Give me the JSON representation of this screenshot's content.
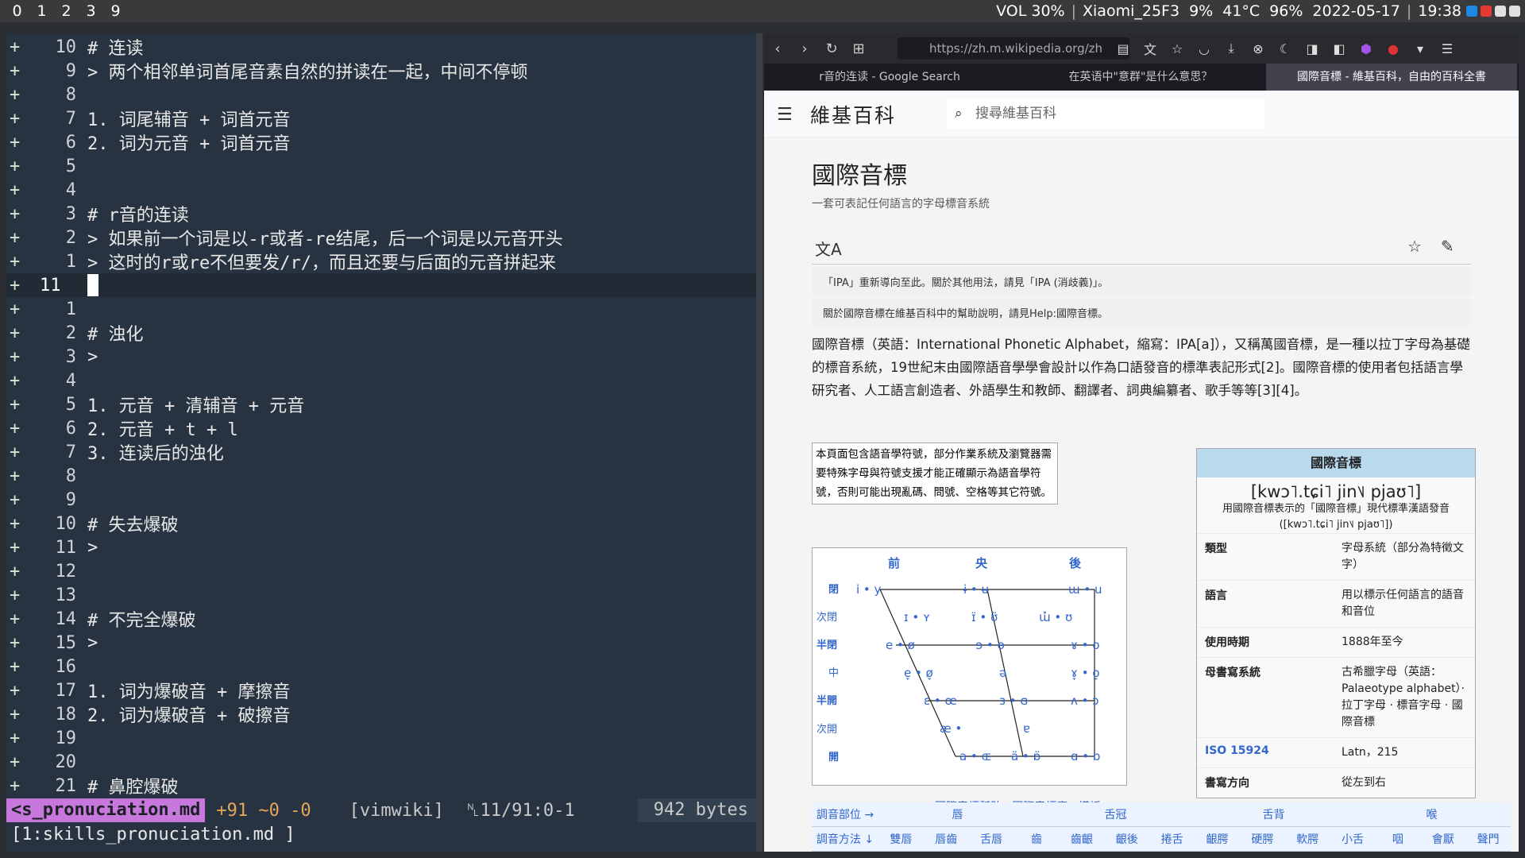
{
  "topbar": {
    "workspaces": [
      "0",
      "1",
      "2",
      "3",
      "9"
    ],
    "volume": "VOL 30%",
    "wifi": "Xiaomi_25F3",
    "cpu": "9%",
    "temp": "41°C",
    "battery": "96%",
    "date": "2022-05-17",
    "time": "19:38"
  },
  "vim": {
    "lines": [
      {
        "plus": "+",
        "num": "10",
        "text": "# 连读"
      },
      {
        "plus": "+",
        "num": "9",
        "text": "> 两个相邻单词首尾音素自然的拼读在一起，中间不停顿"
      },
      {
        "plus": "+",
        "num": "8",
        "text": ""
      },
      {
        "plus": "+",
        "num": "7",
        "text": "1. 词尾辅音 + 词首元音"
      },
      {
        "plus": "+",
        "num": "6",
        "text": "2. 词为元音 + 词首元音"
      },
      {
        "plus": "+",
        "num": "5",
        "text": ""
      },
      {
        "plus": "+",
        "num": "4",
        "text": ""
      },
      {
        "plus": "+",
        "num": "3",
        "text": "# r音的连读"
      },
      {
        "plus": "+",
        "num": "2",
        "text": "> 如果前一个词是以-r或者-re结尾，后一个词是以元音开头"
      },
      {
        "plus": "+",
        "num": "1",
        "text": "> 这时的r或re不但要发/r/，而且还要与后面的元音拼起来"
      },
      {
        "plus": "+",
        "num": "11",
        "text": "",
        "current": true
      },
      {
        "plus": "+",
        "num": "1",
        "text": ""
      },
      {
        "plus": "+",
        "num": "2",
        "text": "# 浊化"
      },
      {
        "plus": "+",
        "num": "3",
        "text": ">"
      },
      {
        "plus": "+",
        "num": "4",
        "text": ""
      },
      {
        "plus": "+",
        "num": "5",
        "text": "1. 元音 + 清辅音 + 元音"
      },
      {
        "plus": "+",
        "num": "6",
        "text": "2. 元音 + t + l"
      },
      {
        "plus": "+",
        "num": "7",
        "text": "3. 连读后的浊化"
      },
      {
        "plus": "+",
        "num": "8",
        "text": ""
      },
      {
        "plus": "+",
        "num": "9",
        "text": ""
      },
      {
        "plus": "+",
        "num": "10",
        "text": "# 失去爆破"
      },
      {
        "plus": "+",
        "num": "11",
        "text": ">"
      },
      {
        "plus": "+",
        "num": "12",
        "text": ""
      },
      {
        "plus": "+",
        "num": "13",
        "text": ""
      },
      {
        "plus": "+",
        "num": "14",
        "text": "# 不完全爆破"
      },
      {
        "plus": "+",
        "num": "15",
        "text": ">"
      },
      {
        "plus": "+",
        "num": "16",
        "text": ""
      },
      {
        "plus": "+",
        "num": "17",
        "text": "1. 词为爆破音 + 摩擦音"
      },
      {
        "plus": "+",
        "num": "18",
        "text": "2. 词为爆破音 + 破擦音"
      },
      {
        "plus": "+",
        "num": "19",
        "text": ""
      },
      {
        "plus": "+",
        "num": "20",
        "text": ""
      },
      {
        "plus": "+",
        "num": "21",
        "text": "# 鼻腔爆破"
      }
    ],
    "statusline": {
      "filename": "<s_pronuciation.md",
      "diff": "+91 ~0 -0",
      "filetype": "[vimwiki]",
      "position": "␤11/91:0-1",
      "bytes": "942 bytes"
    },
    "bufferline": "[1:skills_pronuciation.md ]"
  },
  "browser": {
    "url": "https://zh.m.wikipedia.org/zh",
    "tabs": [
      {
        "label": "r音的连读 - Google Search",
        "active": false
      },
      {
        "label": "在英语中\"意群\"是什么意思？",
        "active": false
      },
      {
        "label": "國際音標 - 維基百科，自由的百科全書",
        "active": true
      }
    ],
    "wiki": {
      "logo": "維基百科",
      "search_placeholder": "搜尋維基百科",
      "title": "國際音標",
      "subtitle": "一套可表記任何語言的字母標音系統",
      "hatnote1": "「IPA」重新導向至此。關於其他用法，請見「IPA (消歧義)」。",
      "hatnote2": "關於國際音標在維基百科中的幫助說明，請見Help:國際音標。",
      "para": "國際音標（英語：International Phonetic Alphabet，縮寫：IPA[a]），又稱萬國音標，是一種以拉丁字母為基礎的標音系統，19世紀末由國際語音學學會設計以作為口語發音的標準表記形式[2]。國際音標的使用者包括語言學研究者、人工語言創造者、外語學生和教師、翻譯者、詞典編纂者、歌手等等[3][4]。",
      "notice": "本頁面包含語音學符號，部分作業系統及瀏覽器需要特殊字母與符號支援才能正確顯示為語音學符號，否則可能出現亂碼、問號、空格等其它符號。",
      "chart_headers": [
        "前",
        "央",
        "後"
      ],
      "chart_rows": [
        "閉",
        "次閉",
        "半閉",
        "中",
        "半開",
        "次開",
        "開"
      ],
      "chart_links": "國際音標幫助 · 國際音標表 · 模板",
      "infobox": {
        "heading": "國際音標",
        "ipa": "[kwɔ˥.tɕi˥ jin˥˩ pjaʊ˥]",
        "caption": "用國際音標表示的「國際音標」現代標準漢語發音 ([kwɔ˥.tɕi˥ jin˥˩ pjaʊ˥])",
        "rows": [
          {
            "k": "類型",
            "v": "字母系統（部分為特徵文字）"
          },
          {
            "k": "語言",
            "v": "用以標示任何語言的語音和音位"
          },
          {
            "k": "使用時期",
            "v": "1888年至今"
          },
          {
            "k": "母書寫系統",
            "v": "古希臘字母（英語：Palaeotype alphabet）· 拉丁字母 · 標音字母 · 國際音標"
          },
          {
            "k": "ISO 15924",
            "v": "Latn，215"
          },
          {
            "k": "書寫方向",
            "v": "從左到右"
          }
        ]
      },
      "table_row1": [
        "調音部位 →",
        "唇",
        "舌冠",
        "舌背",
        "喉"
      ],
      "table_row2": [
        "調音方法 ↓",
        "雙唇",
        "唇齒",
        "舌唇",
        "齒",
        "齒齦",
        "齦後",
        "捲舌",
        "齦腭",
        "硬腭",
        "軟腭",
        "小舌",
        "咽",
        "會厭",
        "聲門"
      ]
    }
  }
}
